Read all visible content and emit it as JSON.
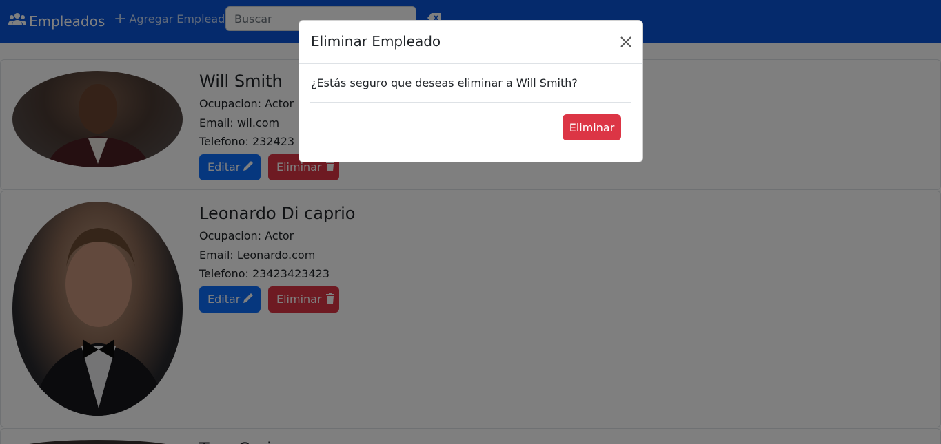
{
  "navbar": {
    "brand": "Empleados",
    "add_link": "Agregar Empleado",
    "search_placeholder": "Buscar"
  },
  "employees": [
    {
      "name": "Will Smith",
      "ocupacion": "Ocupacion: Actor",
      "email": "Email: wil.com",
      "telefono": "Telefono: 232423"
    },
    {
      "name": "Leonardo Di caprio",
      "ocupacion": "Ocupacion: Actor",
      "email": "Email: Leonardo.com",
      "telefono": "Telefono: 23423423423"
    },
    {
      "name": "Tom Cruise"
    }
  ],
  "buttons": {
    "edit": "Editar",
    "delete": "Eliminar"
  },
  "modal": {
    "title": "Eliminar Empleado",
    "message": "¿Estás seguro que deseas eliminar a Will Smith?",
    "confirm": "Eliminar"
  },
  "colors": {
    "navbar": "#0b54d8",
    "primary": "#0d6efd",
    "danger": "#dc3545"
  },
  "icons": [
    "users-icon",
    "plus-icon",
    "backspace-icon",
    "pencil-icon",
    "trash-icon",
    "close-icon"
  ]
}
